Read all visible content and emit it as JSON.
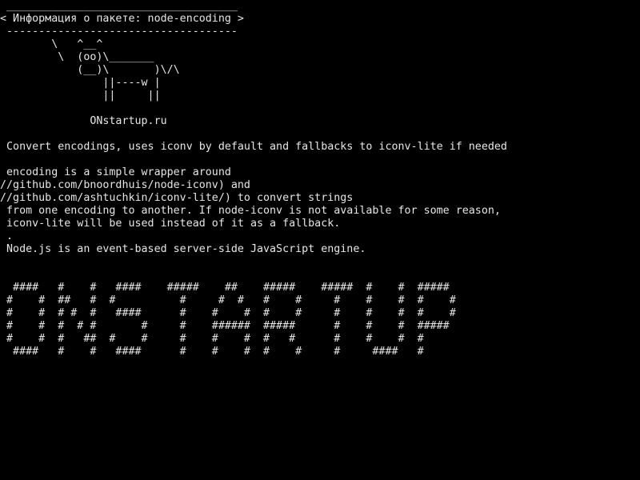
{
  "theme": {
    "background": "#000000",
    "foreground": "#e6e6e6"
  },
  "speech_bubble": {
    "top_border": " ____________________________________",
    "text": "< Информация о пакете: node-encoding >",
    "bottom_border": " ------------------------------------"
  },
  "cow": {
    "line1": "        \\   ^__^",
    "line2": "         \\  (oo)\\_______",
    "line3": "            (__)\\       )\\/\\",
    "line4": "                ||----w |",
    "line5": "                ||     ||"
  },
  "site": "              ONstartup.ru",
  "description": {
    "summary": " Convert encodings, uses iconv by default and fallbacks to iconv-lite if needed",
    "body": [
      " encoding is a simple wrapper around",
      "//github.com/bnoordhuis/node-iconv) and",
      "//github.com/ashtuchkin/iconv-lite/) to convert strings",
      " from one encoding to another. If node-iconv is not available for some reason,",
      " iconv-lite will be used instead of it as a fallback.",
      " .",
      " Node.js is an event-based server-side JavaScript engine."
    ]
  },
  "banner": [
    "  ####   #    #   ####    #####    ##    #####    #####  #    #  #####",
    " #    #  ##   #  #          #     #  #   #    #     #    #    #  #    #",
    " #    #  # #  #   ####      #    #    #  #    #     #    #    #  #    #",
    " #    #  #  # #       #     #    ######  #####      #    #    #  #####",
    " #    #  #   ##  #    #     #    #    #  #   #      #    #    #  #",
    "  ####   #    #   ####      #    #    #  #    #     #     ####   #"
  ]
}
